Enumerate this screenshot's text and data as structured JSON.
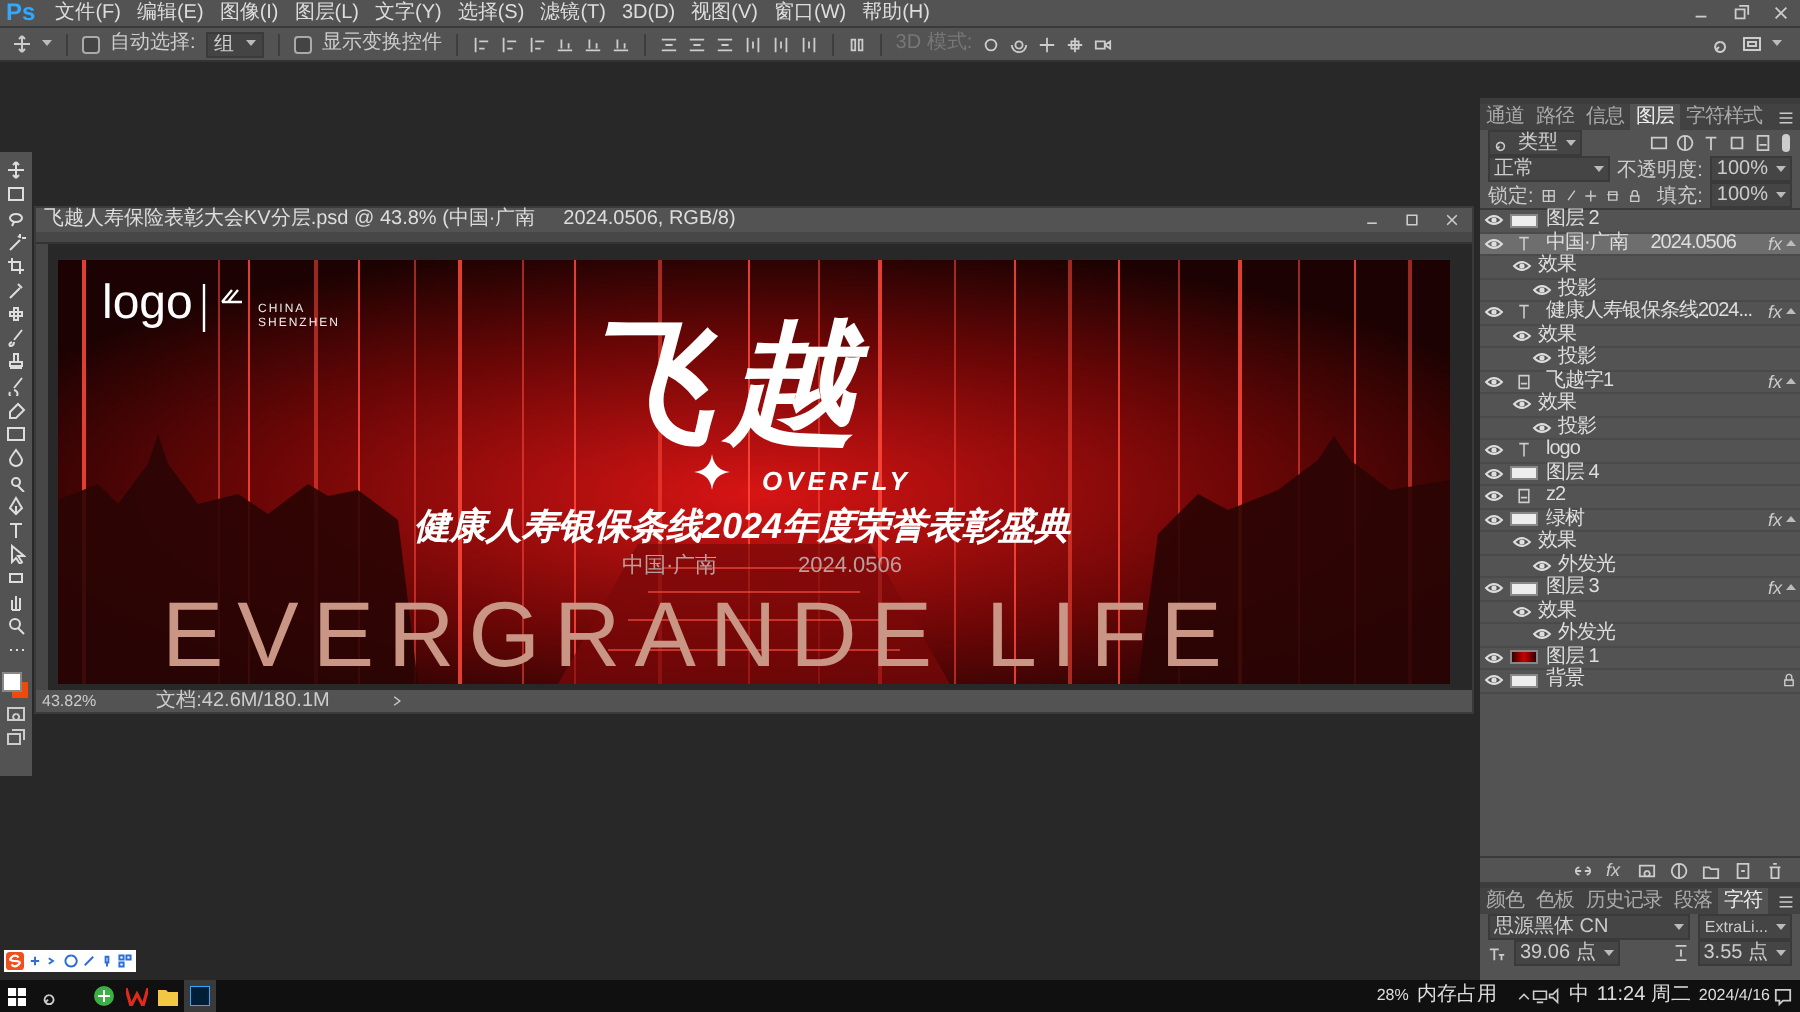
{
  "app": {
    "logo": "Ps"
  },
  "menu": [
    "文件(F)",
    "编辑(E)",
    "图像(I)",
    "图层(L)",
    "文字(Y)",
    "选择(S)",
    "滤镜(T)",
    "3D(D)",
    "视图(V)",
    "窗口(W)",
    "帮助(H)"
  ],
  "options_bar": {
    "auto_select": {
      "label": "自动选择:",
      "checked": false
    },
    "target": {
      "value": "组"
    },
    "transform_controls": {
      "label": "显示变换控件",
      "checked": false
    },
    "mode_3d": {
      "label": "3D 模式:",
      "disabled": true
    }
  },
  "document": {
    "title": "飞越人寿保险表彰大会KV分层.psd @ 43.8% (中国·广南     2024.0506, RGB/8)",
    "banner": {
      "logo": "logo",
      "logo_line_1": "CHINA",
      "logo_line_2": "SHENZHEN",
      "headline": "飞越",
      "headline_en": "OVERFLY",
      "subtitle": "健康人寿银保条线2024年度荣誉表彰盛典",
      "location": "中国·广南",
      "date": "2024.0506",
      "slogan": "EVERGRANDE LIFE"
    },
    "zoom": "43.82%",
    "doc_size": "文档:42.6M/180.1M"
  },
  "layers_panel": {
    "tabs": [
      {
        "label": "通道",
        "selected": false
      },
      {
        "label": "路径",
        "selected": false
      },
      {
        "label": "信息",
        "selected": false
      },
      {
        "label": "图层",
        "selected": true
      },
      {
        "label": "字符样式",
        "selected": false
      }
    ],
    "filter": "类型",
    "blend_mode": "正常",
    "opacity_label": "不透明度:",
    "opacity": "100%",
    "lock_label": "锁定:",
    "fill_label": "填充:",
    "fill": "100%",
    "fx_button": "fx",
    "layers": [
      {
        "name": "图层 2",
        "kind": "pixel",
        "visible": true,
        "selected": false,
        "locked": false
      },
      {
        "name": "中国·广南     2024.0506",
        "kind": "text",
        "visible": true,
        "selected": true,
        "locked": false,
        "badge": "fx",
        "expanded": true,
        "effects": [
          {
            "name": "效果",
            "visible": true,
            "children": [
              {
                "name": "投影",
                "visible": true
              }
            ]
          }
        ]
      },
      {
        "name": "健康人寿银保条线2024...",
        "kind": "text",
        "visible": true,
        "selected": false,
        "locked": false,
        "badge": "fx",
        "expanded": true,
        "effects": [
          {
            "name": "效果",
            "visible": true,
            "children": [
              {
                "name": "投影",
                "visible": true
              }
            ]
          }
        ]
      },
      {
        "name": "飞越字1",
        "kind": "smart",
        "visible": true,
        "selected": false,
        "locked": false,
        "badge": "fx",
        "expanded": true,
        "effects": [
          {
            "name": "效果",
            "visible": true,
            "children": [
              {
                "name": "投影",
                "visible": true
              }
            ]
          }
        ]
      },
      {
        "name": "logo",
        "kind": "text",
        "visible": true,
        "selected": false,
        "locked": false
      },
      {
        "name": "图层 4",
        "kind": "pixel",
        "visible": true,
        "selected": false,
        "locked": false
      },
      {
        "name": "z2",
        "kind": "smart",
        "visible": true,
        "selected": false,
        "locked": false
      },
      {
        "name": "绿树",
        "kind": "pixel",
        "visible": true,
        "selected": false,
        "locked": false,
        "badge": "fx",
        "expanded": true,
        "effects": [
          {
            "name": "效果",
            "visible": true,
            "children": [
              {
                "name": "外发光",
                "visible": true
              }
            ]
          }
        ]
      },
      {
        "name": "图层 3",
        "kind": "pixel",
        "visible": true,
        "selected": false,
        "locked": false,
        "badge": "fx",
        "expanded": true,
        "effects": [
          {
            "name": "效果",
            "visible": true,
            "children": [
              {
                "name": "外发光",
                "visible": true
              }
            ]
          }
        ]
      },
      {
        "name": "图层 1",
        "kind": "image",
        "visible": true,
        "selected": false,
        "locked": false
      },
      {
        "name": "背景",
        "kind": "pixel",
        "visible": true,
        "selected": false,
        "locked": true
      }
    ]
  },
  "character_panel": {
    "tabs": [
      {
        "label": "颜色",
        "selected": false
      },
      {
        "label": "色板",
        "selected": false
      },
      {
        "label": "历史记录",
        "selected": false
      },
      {
        "label": "段落",
        "selected": false
      },
      {
        "label": "字符",
        "selected": true
      }
    ],
    "font_family": "思源黑体 CN",
    "font_style": "ExtraLi...",
    "font_size": "39.06 点",
    "leading": "3.55 点"
  },
  "taskbar": {
    "memory": "28%",
    "memory_label": "内存占用",
    "ime": "中",
    "time": "11:24 周二",
    "date": "2024/4/16"
  }
}
